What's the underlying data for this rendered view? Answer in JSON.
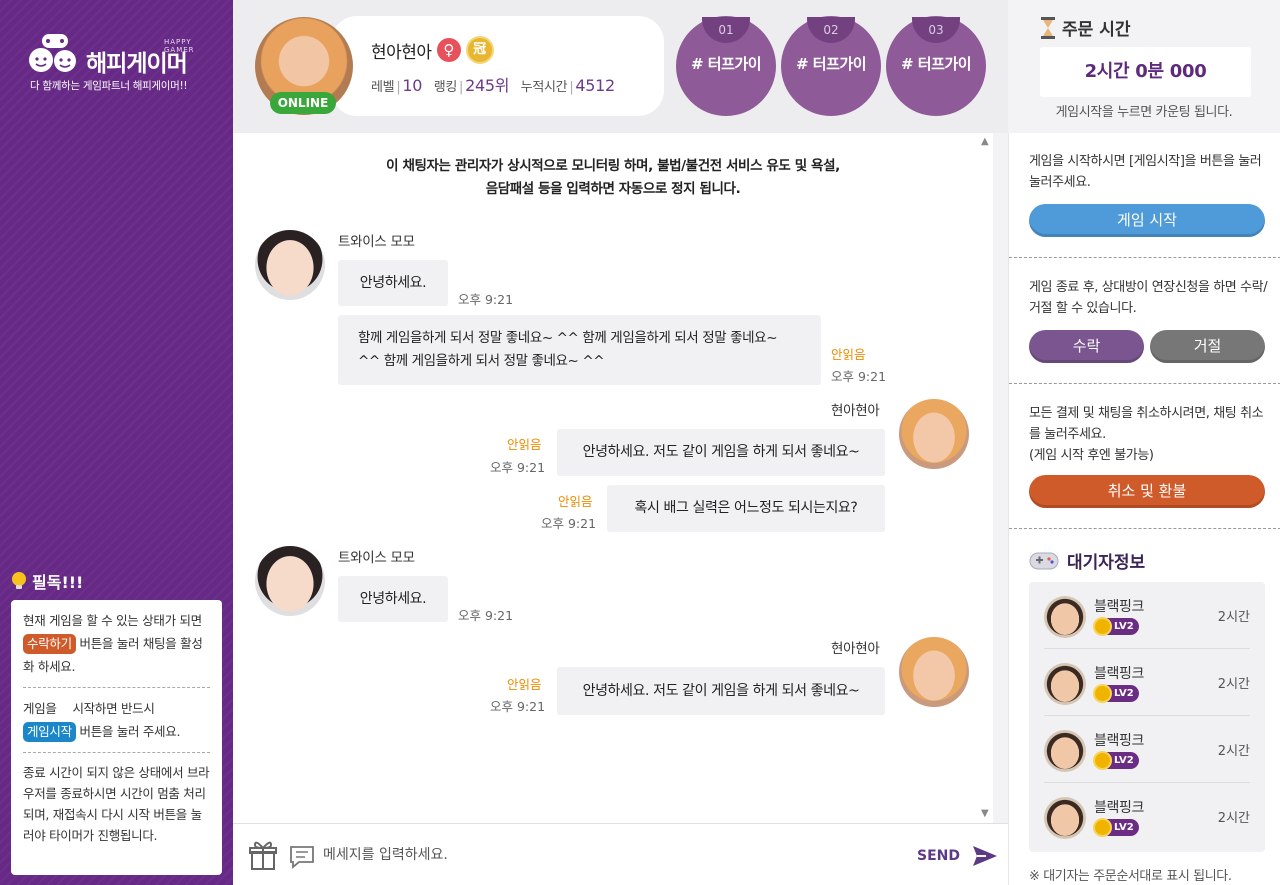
{
  "brand": {
    "name": "해피게이머",
    "sub": "HAPPY GAMER",
    "tagline": "다 함께하는 게임파트너 해피게이머!!"
  },
  "notice": {
    "title": "필독!!!",
    "b1_pre": "현재 게임을 할 수 있는 상태가 되면",
    "b1_pill": "수락하기",
    "b1_post": "버튼을 눌러 채팅을 활성화 하세요.",
    "b2_pre": "게임을 　시작하면 반드시",
    "b2_pill": "게임시작",
    "b2_post": "버튼을 눌러 주세요.",
    "b3": "종료 시간이 되지 않은 상태에서 브라우저를 종료하시면 시간이 멈춤 처리되며, 재접속시 다시 시작 버튼을 눌러야 타이머가 진행됩니다."
  },
  "profile": {
    "status": "ONLINE",
    "name": "현아현아",
    "gender_symbol": "♀",
    "badge_symbol": "冠",
    "level_label": "레벨",
    "level": "10",
    "rank_label": "랭킹",
    "rank": "245위",
    "time_label": "누적시간",
    "time": "4512"
  },
  "tags": [
    {
      "num": "01",
      "text": "# 터프가이"
    },
    {
      "num": "02",
      "text": "# 터프가이"
    },
    {
      "num": "03",
      "text": "# 터프가이"
    }
  ],
  "chat": {
    "notice_line1": "이 채팅자는 관리자가 상시적으로 모니터링 하며, 불법/불건전 서비스 유도 및 욕설,",
    "notice_line2": "음담패설 등을 입력하면 자동으로 정지 됩니다.",
    "momo_name": "트와이스 모모",
    "hyuna_name": "현아현아",
    "m1": "안녕하세요.",
    "m2": "함께 게임을하게 되서 정말 좋네요~ ^^ 함께 게임을하게 되서 정말 좋네요~ ^^ 함께 게임을하게 되서 정말 좋네요~ ^^",
    "m3": "안녕하세요. 저도 같이 게임을 하게 되서 좋네요~",
    "m4": "혹시 배그 실력은 어느정도 되시는지요?",
    "m5": "안녕하세요.",
    "m6": "안녕하세요. 저도 같이 게임을 하게 되서 좋네요~",
    "time": "오후 9:21",
    "unread": "안읽음"
  },
  "input": {
    "placeholder": "메세지를 입력하세요.",
    "send": "SEND"
  },
  "order": {
    "title": "주문 시간",
    "timer": "2시간 0분 000",
    "note": "게임시작을 누르면 카운팅 됩니다."
  },
  "right": {
    "s1_text": "게임을 시작하시면 [게임시작]을 버튼을 눌러 눌러주세요.",
    "s1_btn": "게임 시작",
    "s2_text": "게임 종료 후, 상대방이 연장신청을 하면 수락/거절 할 수 있습니다.",
    "accept": "수락",
    "reject": "거절",
    "s3_text1": "모든 결제 및 채팅을 취소하시려면, 채팅 취소를 눌러주세요.",
    "s3_text2": "(게임 시작 후엔 불가능)",
    "cancel": "취소 및 환불"
  },
  "waiting": {
    "title": "대기자정보",
    "items": [
      {
        "name": "블랙핑크",
        "level": "LV2",
        "time": "2시간"
      },
      {
        "name": "블랙핑크",
        "level": "LV2",
        "time": "2시간"
      },
      {
        "name": "블랙핑크",
        "level": "LV2",
        "time": "2시간"
      },
      {
        "name": "블랙핑크",
        "level": "LV2",
        "time": "2시간"
      }
    ],
    "note": "※ 대기자는 주문순서대로 표시 됩니다."
  },
  "colors": {
    "purple": "#672986",
    "tag": "#8e5a97",
    "blue_btn": "#4f9bd9",
    "orange_btn": "#cf5a2a",
    "accept": "#7a5590",
    "reject": "#777777"
  }
}
